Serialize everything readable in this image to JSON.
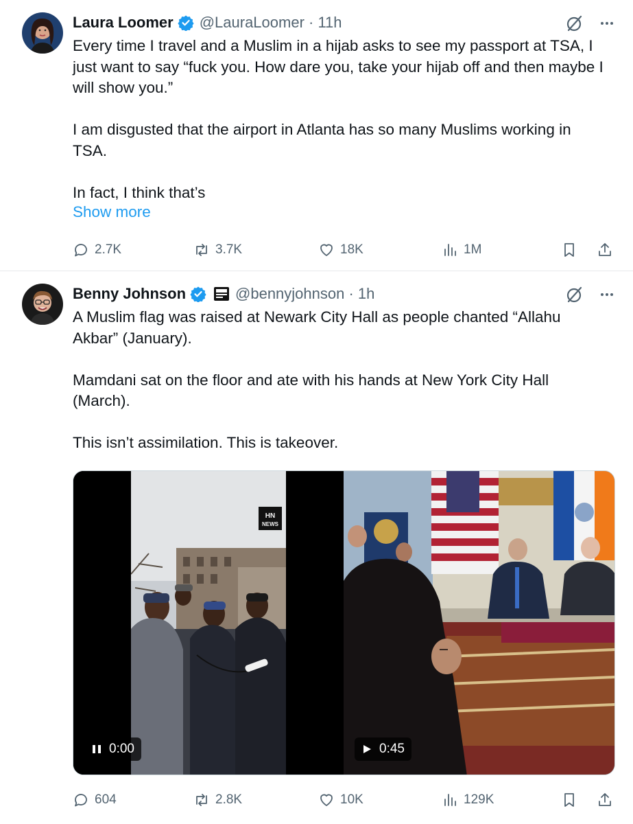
{
  "tweets": [
    {
      "name": "Laura Loomer",
      "handle": "@LauraLoomer · 11h",
      "text": "Every time I travel and a Muslim in a hijab asks to see my passport at TSA, I just want to say “fuck you. How dare you, take your hijab off and then maybe I will show you.”\n\nI am disgusted that the airport in Atlanta has so many Muslims working in TSA.\n\nIn fact, I think that’s",
      "show_more": "Show more",
      "replies": "2.7K",
      "reposts": "3.7K",
      "likes": "18K",
      "views": "1M"
    },
    {
      "name": "Benny Johnson",
      "handle": "@bennyjohnson · 1h",
      "text": "A Muslim flag was raised at Newark City Hall as people chanted “Allahu Akbar” (January).\n\nMamdani sat on the floor and ate with his hands at New York City Hall (March).\n\nThis isn’t assimilation. This is takeover.",
      "videos": [
        {
          "time": "0:00",
          "state": "pause-icon"
        },
        {
          "time": "0:45",
          "state": "play-icon"
        }
      ],
      "replies": "604",
      "reposts": "2.8K",
      "likes": "10K",
      "views": "129K"
    }
  ],
  "colors": {
    "accent": "#1d9bf0",
    "secondary_text": "#536471",
    "primary_text": "#0f1419"
  }
}
